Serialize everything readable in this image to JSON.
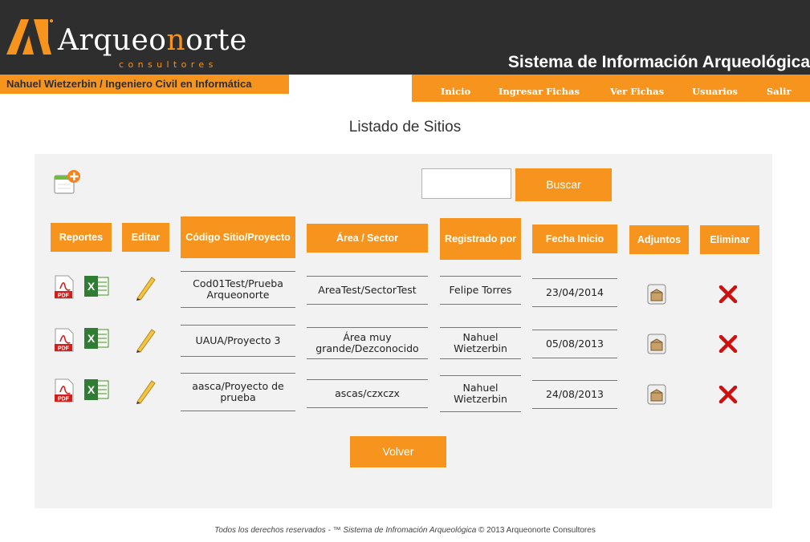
{
  "header": {
    "logo_word_a": "Arqueo",
    "logo_word_o": "n",
    "logo_word_b": "orte",
    "logo_sub": "consultores",
    "system_title": "Sistema de Información Arqueológica",
    "user_label": "Nahuel Wietzerbin / Ingeniero Civil en Informática"
  },
  "nav": {
    "items": [
      "Inicio",
      "Ingresar Fichas",
      "Ver Fichas",
      "Usuarios",
      "Salir"
    ]
  },
  "page": {
    "title": "Listado de Sitios"
  },
  "search": {
    "placeholder": "",
    "value": "",
    "button_label": "Buscar"
  },
  "table": {
    "headers": {
      "reportes": "Reportes",
      "editar": "Editar",
      "codigo": "Código Sitio/Proyecto",
      "area": "Área / Sector",
      "registrado": "Registrado por",
      "fecha": "Fecha Inicio",
      "adjuntos": "Adjuntos",
      "eliminar": "Eliminar"
    },
    "rows": [
      {
        "codigo": "Cod01Test/Prueba Arqueonorte",
        "area": "AreaTest/SectorTest",
        "registrado": "Felipe Torres",
        "fecha": "23/04/2014"
      },
      {
        "codigo": "UAUA/Proyecto 3",
        "area": "Área muy grande/Dezconocido",
        "registrado": "Nahuel Wietzerbin",
        "fecha": "05/08/2013"
      },
      {
        "codigo": "aasca/Proyecto de prueba",
        "area": "ascas/czxczx",
        "registrado": "Nahuel Wietzerbin",
        "fecha": "24/08/2013"
      }
    ]
  },
  "icons": {
    "pdf_label": "PDF",
    "excel_label": "X"
  },
  "buttons": {
    "volver": "Volver"
  },
  "footer": {
    "text_a": "Todos los derechos reservados - ™ Sistema de Infromación Arqueológica",
    "text_b": " © 2013 Arqueonorte Consultores"
  },
  "colors": {
    "accent": "#f7941d",
    "header_bg": "#2e2e2e",
    "panel_bg": "#f2f2f2",
    "delete": "#cc1111"
  }
}
